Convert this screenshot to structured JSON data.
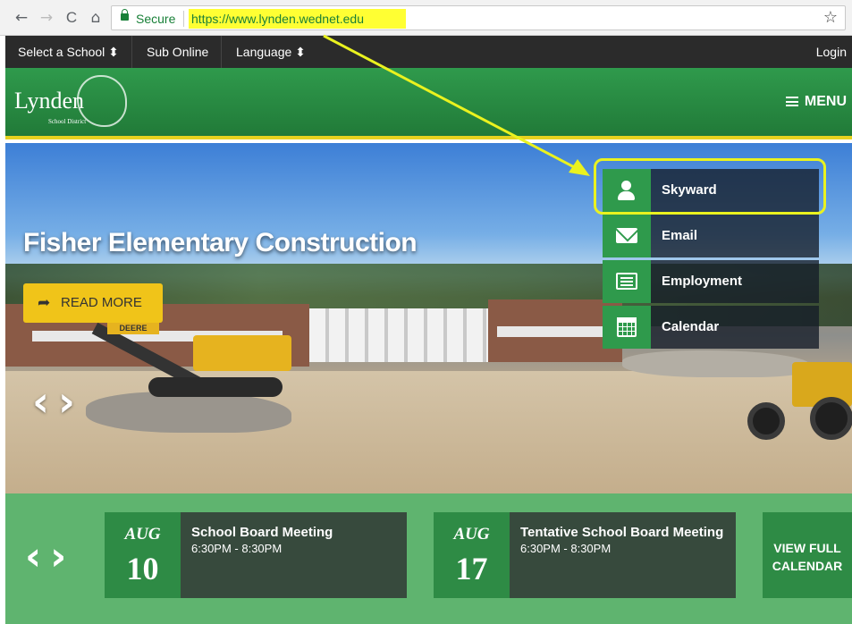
{
  "browser": {
    "back": "←",
    "forward": "→",
    "reload": "C",
    "home": "⌂",
    "secure_label": "Secure",
    "url": "https://www.lynden.wednet.edu",
    "bookmark": "☆"
  },
  "utility": {
    "select_school": "Select a School ⬍",
    "sub_online": "Sub Online",
    "language": "Language ⬍",
    "login": "Login"
  },
  "header": {
    "logo_text": "Lynden",
    "logo_sub": "School District",
    "menu_label": "MENU"
  },
  "hero": {
    "title": "Fisher Elementary Construction",
    "read_more": "READ MORE",
    "share_icon": "➦",
    "prev": "‹",
    "next": "›",
    "equipment_label": "DEERE"
  },
  "quick_links": [
    {
      "label": "Skyward",
      "icon": "person-icon"
    },
    {
      "label": "Email",
      "icon": "envelope-icon"
    },
    {
      "label": "Employment",
      "icon": "board-icon"
    },
    {
      "label": "Calendar",
      "icon": "calendar-icon"
    }
  ],
  "events": {
    "prev": "‹",
    "next": "›",
    "items": [
      {
        "month": "AUG",
        "day": "10",
        "title": "School Board Meeting",
        "time": "6:30PM - 8:30PM"
      },
      {
        "month": "AUG",
        "day": "17",
        "title": "Tentative School Board Meeting",
        "time": "6:30PM - 8:30PM"
      }
    ],
    "view_full_line1": "VIEW FULL",
    "view_full_line2": "CALENDAR"
  },
  "colors": {
    "green": "#2f9a4c",
    "yellow": "#f0c419",
    "highlight": "#eaf21f",
    "dark": "#2b2b2b"
  }
}
